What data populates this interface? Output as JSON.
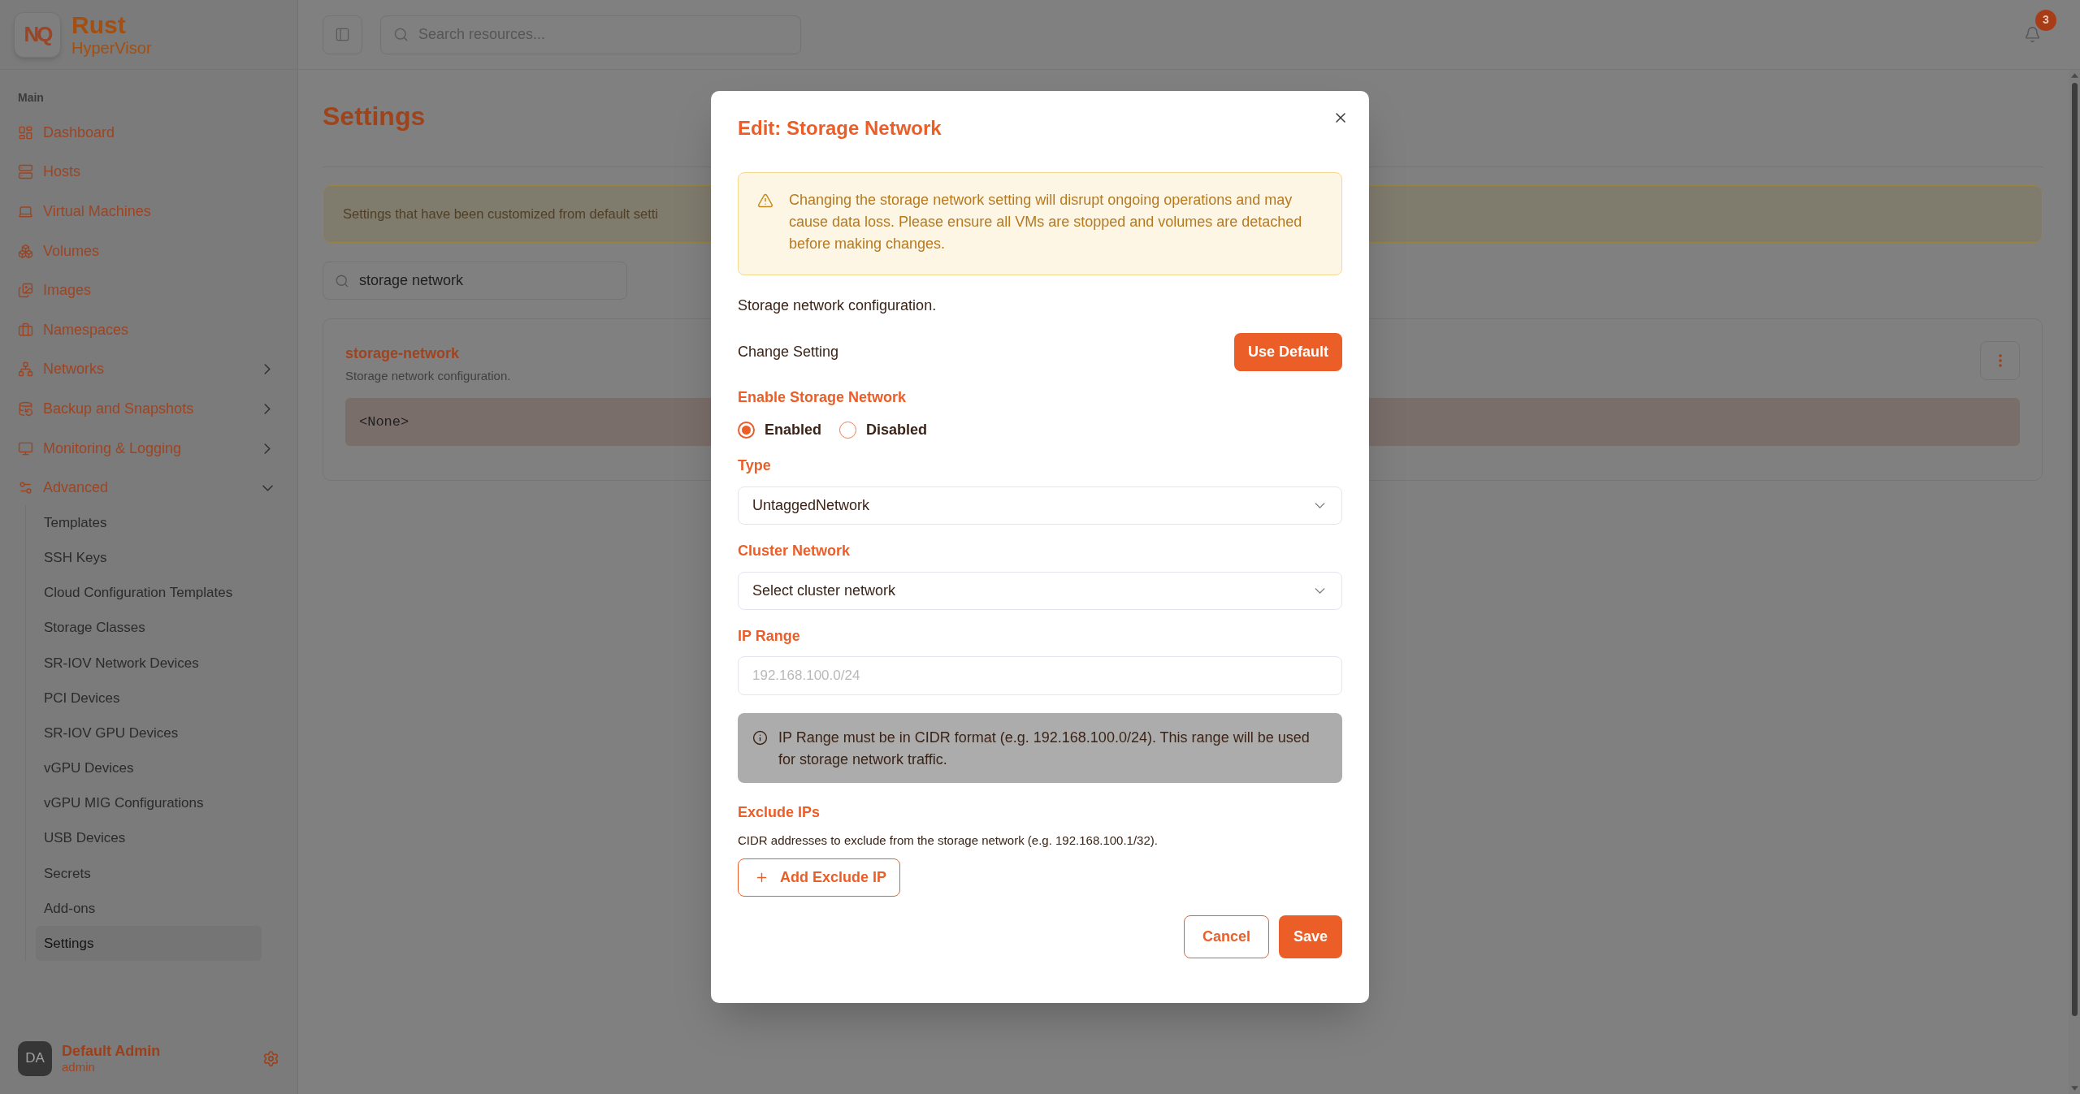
{
  "sidebar": {
    "brand": {
      "logo": "NQ",
      "title": "Rust",
      "subtitle": "HyperVisor"
    },
    "section_label": "Main",
    "items": [
      {
        "label": "Dashboard",
        "kind": "link",
        "selected": false
      },
      {
        "label": "Hosts",
        "kind": "link",
        "selected": false
      },
      {
        "label": "Virtual Machines",
        "kind": "link",
        "selected": false
      },
      {
        "label": "Volumes",
        "kind": "link",
        "selected": false
      },
      {
        "label": "Images",
        "kind": "link",
        "selected": false
      },
      {
        "label": "Namespaces",
        "kind": "link",
        "selected": false
      },
      {
        "label": "Networks",
        "kind": "group",
        "expanded": false
      },
      {
        "label": "Backup and Snapshots",
        "kind": "group",
        "expanded": false
      },
      {
        "label": "Monitoring & Logging",
        "kind": "group",
        "expanded": false
      },
      {
        "label": "Advanced",
        "kind": "group",
        "expanded": true,
        "children": [
          {
            "label": "Templates",
            "selected": false
          },
          {
            "label": "SSH Keys",
            "selected": false
          },
          {
            "label": "Cloud Configuration Templates",
            "selected": false
          },
          {
            "label": "Storage Classes",
            "selected": false
          },
          {
            "label": "SR-IOV Network Devices",
            "selected": false
          },
          {
            "label": "PCI Devices",
            "selected": false
          },
          {
            "label": "SR-IOV GPU Devices",
            "selected": false
          },
          {
            "label": "vGPU Devices",
            "selected": false
          },
          {
            "label": "vGPU MIG Configurations",
            "selected": false
          },
          {
            "label": "USB Devices",
            "selected": false
          },
          {
            "label": "Secrets",
            "selected": false
          },
          {
            "label": "Add-ons",
            "selected": false
          },
          {
            "label": "Settings",
            "selected": true
          }
        ]
      }
    ],
    "user": {
      "initials": "DA",
      "name": "Default Admin",
      "role": "admin"
    }
  },
  "topbar": {
    "search": {
      "placeholder": "Search resources..."
    },
    "notifications": {
      "count": "3"
    }
  },
  "page": {
    "title": "Settings",
    "notice": "Settings that have been customized from default setti",
    "filter": {
      "value": "storage network"
    },
    "settings": [
      {
        "name": "storage-network",
        "description": "Storage network configuration.",
        "value": "<None>"
      }
    ]
  },
  "dialog": {
    "title": "Edit: Storage Network",
    "warning": "Changing the storage network setting will disrupt ongoing operations and may cause data loss. Please ensure all VMs are stopped and volumes are detached before making changes.",
    "description": "Storage network configuration.",
    "change_label": "Change Setting",
    "use_default_button": "Use Default",
    "fields": [
      {
        "kind": "radio",
        "label": "Enable Storage Network",
        "options": [
          {
            "label": "Enabled",
            "selected": true
          },
          {
            "label": "Disabled",
            "selected": false
          }
        ]
      },
      {
        "kind": "select",
        "label": "Type",
        "value": "UntaggedNetwork"
      },
      {
        "kind": "select",
        "label": "Cluster Network",
        "placeholder": "Select cluster network"
      },
      {
        "kind": "text",
        "label": "IP Range",
        "placeholder": "192.168.100.0/24",
        "note": "IP Range must be in CIDR format (e.g. 192.168.100.0/24). This range will be used for storage network traffic."
      },
      {
        "kind": "list",
        "label": "Exclude IPs",
        "help": "CIDR addresses to exclude from the storage network (e.g. 192.168.100.1/32).",
        "add_button": "Add Exclude IP"
      }
    ],
    "buttons": [
      {
        "label": "Cancel",
        "kind": "secondary"
      },
      {
        "label": "Save",
        "kind": "primary"
      }
    ]
  }
}
